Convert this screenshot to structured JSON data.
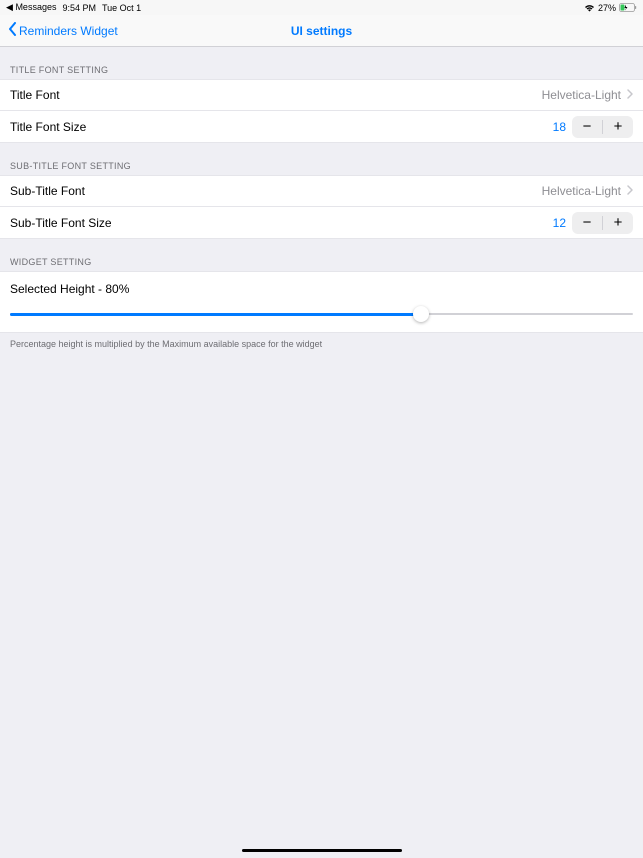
{
  "status": {
    "back_app": "Messages",
    "time": "9:54 PM",
    "date": "Tue Oct 1",
    "battery_pct": "27%"
  },
  "nav": {
    "back_label": "Reminders Widget",
    "title": "UI settings"
  },
  "sections": {
    "title_font": {
      "header": "TITLE FONT SETTING",
      "font_row_label": "Title Font",
      "font_row_value": "Helvetica-Light",
      "size_row_label": "Title Font Size",
      "size_row_value": "18"
    },
    "subtitle_font": {
      "header": "SUB-TITLE FONT SETTING",
      "font_row_label": "Sub-Title Font",
      "font_row_value": "Helvetica-Light",
      "size_row_label": "Sub-Title Font Size",
      "size_row_value": "12"
    },
    "widget": {
      "header": "WIDGET SETTING",
      "slider_label": "Selected Height - 80%",
      "slider_percent": 66,
      "footer": "Percentage height is multiplied by the Maximum available space for the widget"
    }
  }
}
